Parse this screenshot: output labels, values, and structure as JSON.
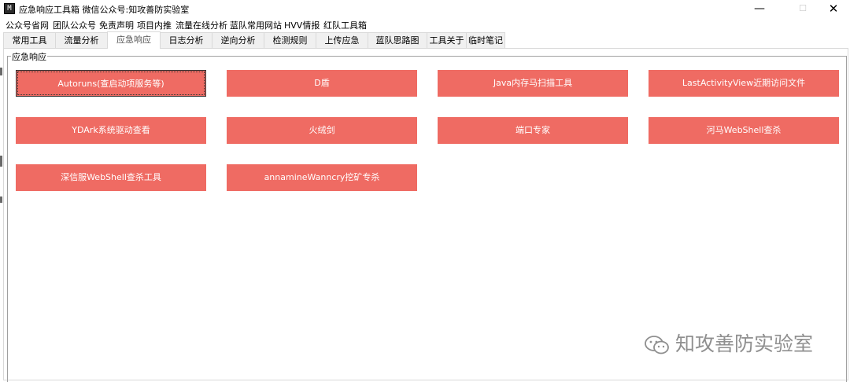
{
  "window": {
    "title": "应急响应工具箱    微信公众号:知攻善防实验室",
    "icon_text": "M",
    "minimize": "—",
    "maximize": "☐",
    "close": "✕"
  },
  "menu": [
    "公众号省网",
    "团队公众号",
    "免责声明",
    "项目内推",
    "流量在线分析",
    "蓝队常用网站",
    "HVV情报",
    "红队工具箱"
  ],
  "tabs": [
    {
      "label": "常用工具",
      "active": false
    },
    {
      "label": "流量分析",
      "active": false
    },
    {
      "label": "应急响应",
      "active": true
    },
    {
      "label": "日志分析",
      "active": false
    },
    {
      "label": "逆向分析",
      "active": false
    },
    {
      "label": "检测规则",
      "active": false
    },
    {
      "label": "上传应急",
      "active": false
    },
    {
      "label": "蓝队思路图",
      "active": false
    },
    {
      "label": "工具关于",
      "active": false
    },
    {
      "label": "临时笔记",
      "active": false
    }
  ],
  "group": {
    "title": "应急响应",
    "buttons": [
      "Autoruns(查启动项服务等)",
      "D盾",
      "Java内存马扫描工具",
      "LastActivityView近期访问文件",
      "YDArk系统驱动查看",
      "火绒剑",
      "端口专家",
      "河马WebShell查杀",
      "深信服WebShell查杀工具",
      "annamineWanncry挖矿专杀"
    ]
  },
  "colors": {
    "button_bg": "#ef6b63",
    "button_text": "#ffffff",
    "watermark": "#8f8f8f"
  },
  "watermark": "知攻善防实验室"
}
